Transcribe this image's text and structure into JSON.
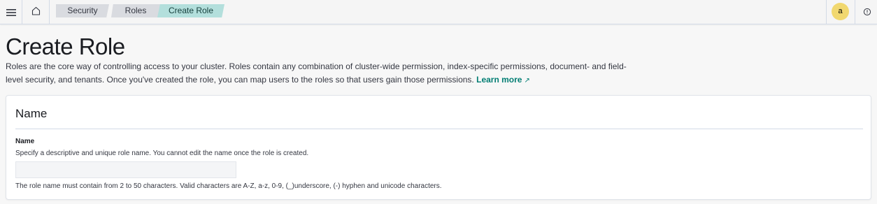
{
  "header": {
    "breadcrumbs": [
      {
        "label": "Security"
      },
      {
        "label": "Roles"
      },
      {
        "label": "Create Role"
      }
    ],
    "avatar_initial": "a"
  },
  "page": {
    "title": "Create Role",
    "description": "Roles are the core way of controlling access to your cluster. Roles contain any combination of cluster-wide permission, index-specific permissions, document- and field-level security, and tenants. Once you've created the role, you can map users to the roles so that users gain those permissions.",
    "learn_more": "Learn more"
  },
  "name_panel": {
    "title": "Name",
    "field_label": "Name",
    "field_help": "Specify a descriptive and unique role name. You cannot edit the name once the role is created.",
    "input_value": "",
    "input_placeholder": "",
    "field_note": "The role name must contain from 2 to 50 characters. Valid characters are A-Z, a-z, 0-9, (_)underscore, (-) hyphen and unicode characters."
  },
  "colors": {
    "accent": "#017d73",
    "active_crumb": "#b3dfdc",
    "avatar": "#f1d86f"
  },
  "icons": [
    "menu-icon",
    "home-icon",
    "help-icon",
    "external-link-icon"
  ]
}
